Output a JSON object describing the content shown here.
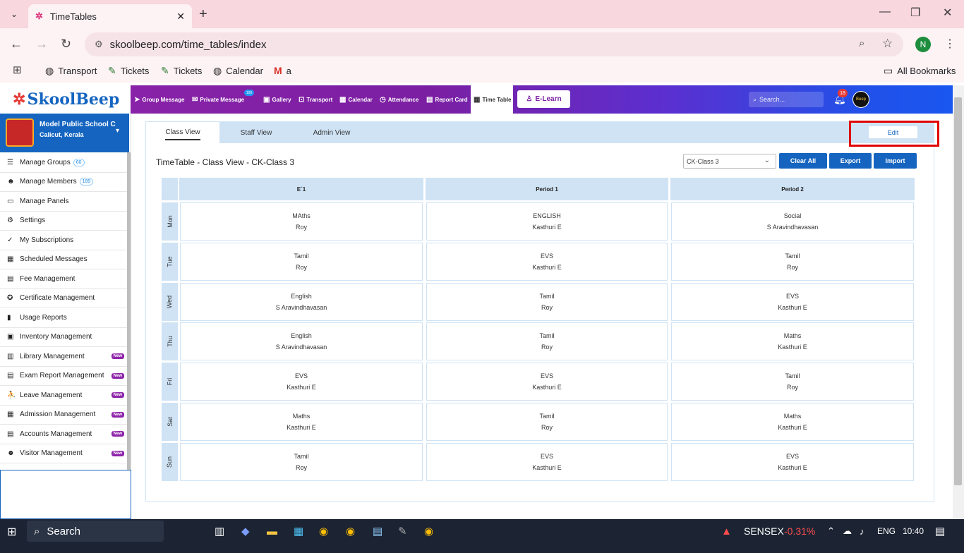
{
  "browser": {
    "tab_title": "TimeTables",
    "url": "skoolbeep.com/time_tables/index",
    "profile_initial": "N",
    "bookmarks": [
      "Transport",
      "Tickets",
      "Tickets",
      "Calendar",
      "a"
    ],
    "all_bookmarks": "All Bookmarks"
  },
  "app": {
    "logo": "SkoolBeep",
    "nav": [
      "Group Message",
      "Private Message",
      "Gallery",
      "Transport",
      "Calendar",
      "Attendance",
      "Report Card",
      "Time Table"
    ],
    "private_badge": "100",
    "elearn": "E-Learn",
    "search_placeholder": "Search...",
    "notif_count": "18",
    "profile_label": "Beep"
  },
  "school": {
    "name": "Model Public School C",
    "location": "Calicut, Kerala"
  },
  "sidebar": [
    {
      "label": "Manage Groups",
      "icon": "list-icon",
      "count": "60",
      "new": ""
    },
    {
      "label": "Manage Members",
      "icon": "users-icon",
      "count": "189",
      "new": ""
    },
    {
      "label": "Manage Panels",
      "icon": "monitor-icon",
      "count": "",
      "new": ""
    },
    {
      "label": "Settings",
      "icon": "gear-icon",
      "count": "",
      "new": ""
    },
    {
      "label": "My Subscriptions",
      "icon": "check-icon",
      "count": "",
      "new": ""
    },
    {
      "label": "Scheduled Messages",
      "icon": "calendar-icon",
      "count": "",
      "new": ""
    },
    {
      "label": "Fee Management",
      "icon": "file-icon",
      "count": "",
      "new": ""
    },
    {
      "label": "Certificate Management",
      "icon": "certificate-icon",
      "count": "",
      "new": ""
    },
    {
      "label": "Usage Reports",
      "icon": "bar-chart-icon",
      "count": "",
      "new": ""
    },
    {
      "label": "Inventory Management",
      "icon": "inventory-icon",
      "count": "",
      "new": ""
    },
    {
      "label": "Library Management",
      "icon": "book-icon",
      "count": "",
      "new": "New"
    },
    {
      "label": "Exam Report Management",
      "icon": "report-icon",
      "count": "",
      "new": "New"
    },
    {
      "label": "Leave Management",
      "icon": "leave-icon",
      "count": "",
      "new": "New"
    },
    {
      "label": "Admission Management",
      "icon": "admission-icon",
      "count": "",
      "new": "New"
    },
    {
      "label": "Accounts Management",
      "icon": "accounts-icon",
      "count": "",
      "new": "New"
    },
    {
      "label": "Visitor Management",
      "icon": "visitor-icon",
      "count": "",
      "new": "New"
    }
  ],
  "timetable": {
    "tabs": [
      "Class View",
      "Staff View",
      "Admin View"
    ],
    "edit": "Edit",
    "title": "TimeTable - Class View - CK-Class 3",
    "selected_class": "CK-Class 3",
    "actions": [
      "Clear All",
      "Export",
      "Import"
    ],
    "columns": [
      "E`1",
      "Period 1",
      "Period 2"
    ],
    "days": [
      "Mon",
      "Tue",
      "Wed",
      "Thu",
      "Fri",
      "Sat",
      "Sun"
    ],
    "rows": [
      [
        [
          "MAths",
          "Roy"
        ],
        [
          "ENGLISH",
          "Kasthuri E"
        ],
        [
          "Social",
          "S Aravindhavasan"
        ]
      ],
      [
        [
          "Tamil",
          "Roy"
        ],
        [
          "EVS",
          "Kasthuri E"
        ],
        [
          "Tamil",
          "Roy"
        ]
      ],
      [
        [
          "English",
          "S Aravindhavasan"
        ],
        [
          "Tamil",
          "Roy"
        ],
        [
          "EVS",
          "Kasthuri E"
        ]
      ],
      [
        [
          "English",
          "S Aravindhavasan"
        ],
        [
          "Tamil",
          "Roy"
        ],
        [
          "Maths",
          "Kasthuri E"
        ]
      ],
      [
        [
          "EVS",
          "Kasthuri E"
        ],
        [
          "EVS",
          "Kasthuri E"
        ],
        [
          "Tamil",
          "Roy"
        ]
      ],
      [
        [
          "Maths",
          "Kasthuri E"
        ],
        [
          "Tamil",
          "Roy"
        ],
        [
          "Maths",
          "Kasthuri E"
        ]
      ],
      [
        [
          "Tamil",
          "Roy"
        ],
        [
          "EVS",
          "Kasthuri E"
        ],
        [
          "EVS",
          "Kasthuri E"
        ]
      ]
    ]
  },
  "taskbar": {
    "search": "Search",
    "ticker": "SENSEX",
    "change": "-0.31%",
    "lang": "ENG",
    "time": "10:40",
    "colors": {
      "negative": "#ff4d4d"
    }
  }
}
